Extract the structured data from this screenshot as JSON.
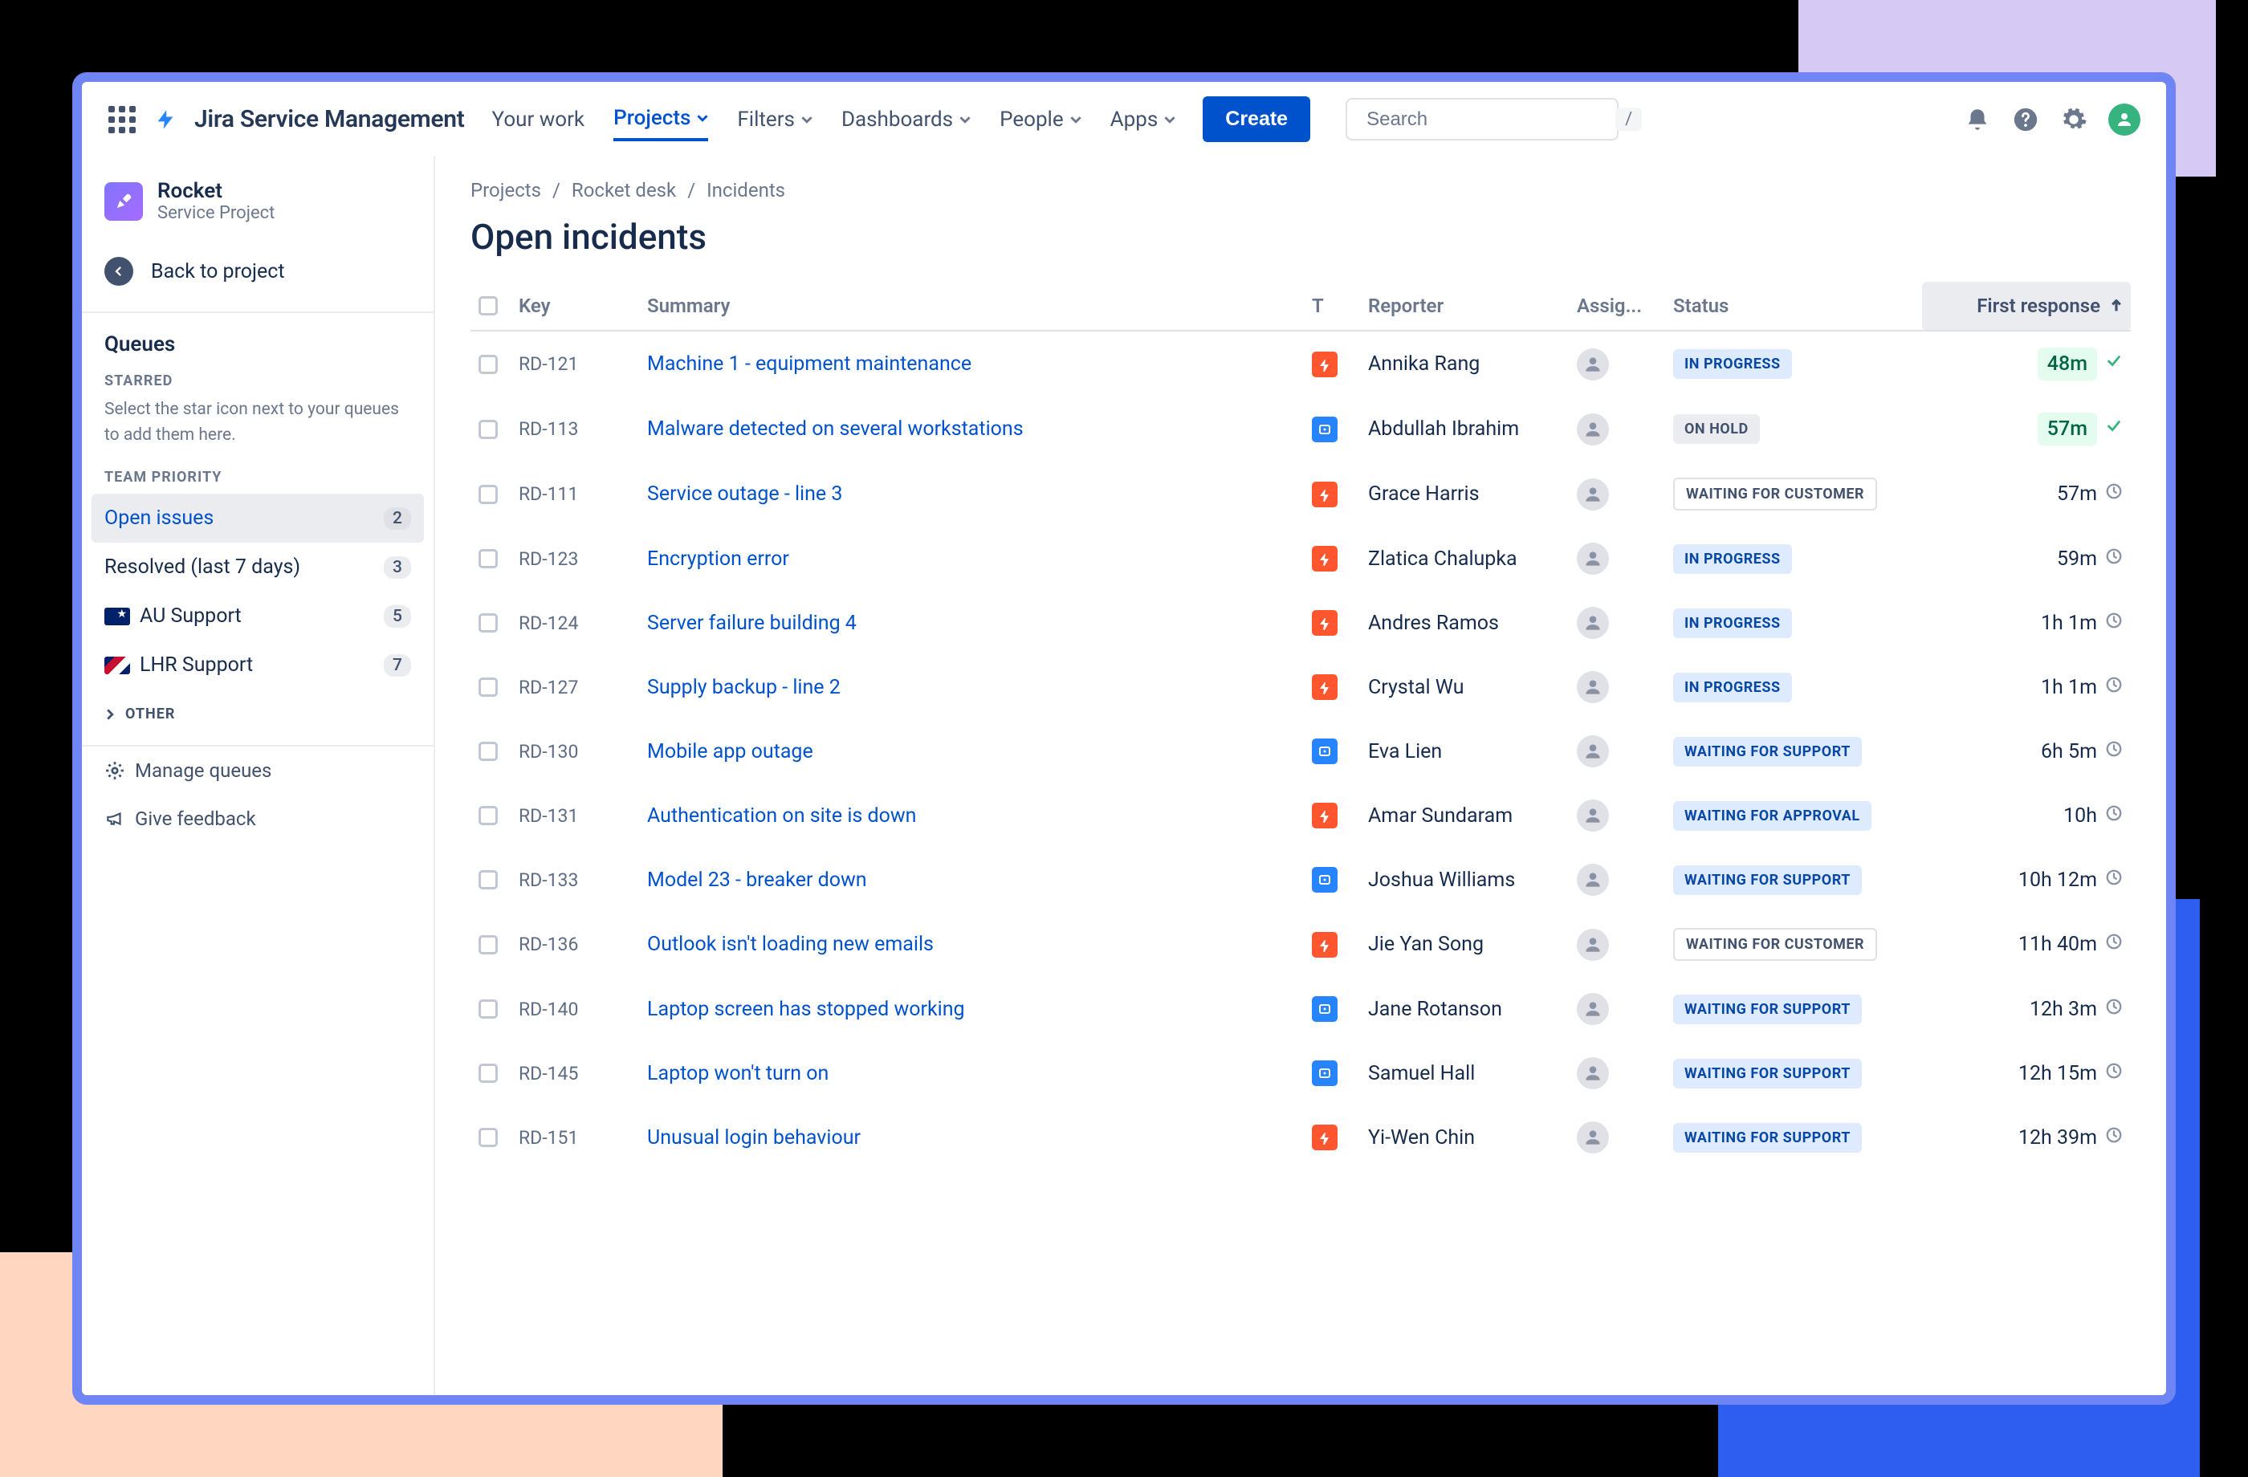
{
  "brand": "Jira Service Management",
  "nav": {
    "your_work": "Your work",
    "projects": "Projects",
    "filters": "Filters",
    "dashboards": "Dashboards",
    "people": "People",
    "apps": "Apps"
  },
  "create_label": "Create",
  "search_placeholder": "Search",
  "search_kbd": "/",
  "sidebar": {
    "project_name": "Rocket",
    "project_type": "Service Project",
    "back_label": "Back to project",
    "queues_title": "Queues",
    "starred_caps": "STARRED",
    "starred_hint": "Select the star icon next to your queues to add them here.",
    "team_caps": "TEAM PRIORITY",
    "items": [
      {
        "label": "Open issues",
        "count": "2",
        "active": true,
        "flag": ""
      },
      {
        "label": "Resolved (last 7 days)",
        "count": "3",
        "active": false,
        "flag": ""
      },
      {
        "label": "AU Support",
        "count": "5",
        "active": false,
        "flag": "au"
      },
      {
        "label": "LHR Support",
        "count": "7",
        "active": false,
        "flag": "uk"
      }
    ],
    "other_caps": "OTHER",
    "manage_label": "Manage queues",
    "feedback_label": "Give feedback"
  },
  "breadcrumbs": [
    "Projects",
    "Rocket desk",
    "Incidents"
  ],
  "page_title": "Open incidents",
  "columns": {
    "key": "Key",
    "summary": "Summary",
    "type": "T",
    "reporter": "Reporter",
    "assignee": "Assig...",
    "status": "Status",
    "first_response": "First response"
  },
  "rows": [
    {
      "key": "RD-121",
      "summary": "Machine 1 - equipment maintenance",
      "type": "urgent",
      "reporter": "Annika Rang",
      "status": "IN PROGRESS",
      "status_class": "progress",
      "resp": "48m",
      "resp_state": "done"
    },
    {
      "key": "RD-113",
      "summary": "Malware detected on several workstations",
      "type": "request",
      "reporter": "Abdullah Ibrahim",
      "status": "ON HOLD",
      "status_class": "hold",
      "resp": "57m",
      "resp_state": "done"
    },
    {
      "key": "RD-111",
      "summary": "Service outage - line 3",
      "type": "urgent",
      "reporter": "Grace Harris",
      "status": "WAITING FOR CUSTOMER",
      "status_class": "cust",
      "resp": "57m",
      "resp_state": "pending"
    },
    {
      "key": "RD-123",
      "summary": "Encryption error",
      "type": "urgent",
      "reporter": "Zlatica Chalupka",
      "status": "IN PROGRESS",
      "status_class": "progress",
      "resp": "59m",
      "resp_state": "pending"
    },
    {
      "key": "RD-124",
      "summary": "Server failure building 4",
      "type": "urgent",
      "reporter": "Andres Ramos",
      "status": "IN PROGRESS",
      "status_class": "progress",
      "resp": "1h 1m",
      "resp_state": "pending"
    },
    {
      "key": "RD-127",
      "summary": "Supply backup - line 2",
      "type": "urgent",
      "reporter": "Crystal Wu",
      "status": "IN PROGRESS",
      "status_class": "progress",
      "resp": "1h 1m",
      "resp_state": "pending"
    },
    {
      "key": "RD-130",
      "summary": "Mobile app outage",
      "type": "request",
      "reporter": "Eva Lien",
      "status": "WAITING FOR SUPPORT",
      "status_class": "support",
      "resp": "6h 5m",
      "resp_state": "pending"
    },
    {
      "key": "RD-131",
      "summary": "Authentication on site is down",
      "type": "urgent",
      "reporter": "Amar Sundaram",
      "status": "WAITING FOR APPROVAL",
      "status_class": "approval",
      "resp": "10h",
      "resp_state": "pending"
    },
    {
      "key": "RD-133",
      "summary": "Model 23 - breaker down",
      "type": "request",
      "reporter": "Joshua Williams",
      "status": "WAITING FOR SUPPORT",
      "status_class": "support",
      "resp": "10h 12m",
      "resp_state": "pending"
    },
    {
      "key": "RD-136",
      "summary": "Outlook isn't loading new emails",
      "type": "urgent",
      "reporter": "Jie Yan Song",
      "status": "WAITING FOR CUSTOMER",
      "status_class": "cust",
      "resp": "11h 40m",
      "resp_state": "pending"
    },
    {
      "key": "RD-140",
      "summary": "Laptop screen has stopped working",
      "type": "request",
      "reporter": "Jane Rotanson",
      "status": "WAITING FOR SUPPORT",
      "status_class": "support",
      "resp": "12h 3m",
      "resp_state": "pending"
    },
    {
      "key": "RD-145",
      "summary": "Laptop won't turn on",
      "type": "request",
      "reporter": "Samuel Hall",
      "status": "WAITING FOR SUPPORT",
      "status_class": "support",
      "resp": "12h 15m",
      "resp_state": "pending"
    },
    {
      "key": "RD-151",
      "summary": "Unusual login behaviour",
      "type": "urgent",
      "reporter": "Yi-Wen Chin",
      "status": "WAITING FOR SUPPORT",
      "status_class": "support",
      "resp": "12h 39m",
      "resp_state": "pending"
    }
  ]
}
